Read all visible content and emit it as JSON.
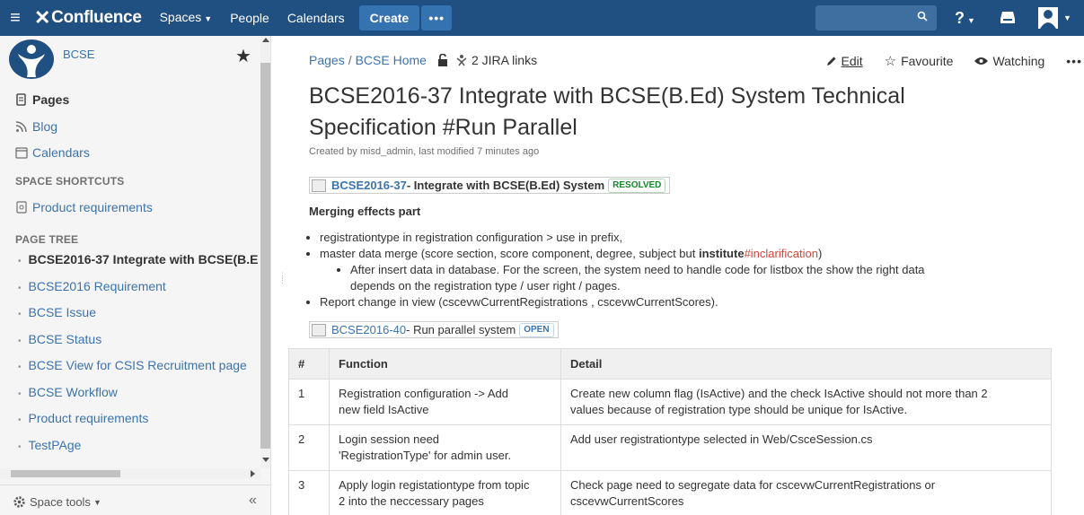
{
  "topbar": {
    "logo": "Confluence",
    "nav": {
      "spaces": "Spaces",
      "people": "People",
      "calendars": "Calendars"
    },
    "create": "Create",
    "more": "•••",
    "colors": {
      "bar": "#205081",
      "button": "#3572b0"
    }
  },
  "sidebar": {
    "space_name": "BCSE",
    "links": {
      "pages": "Pages",
      "blog": "Blog",
      "calendars": "Calendars"
    },
    "shortcuts_heading": "SPACE SHORTCUTS",
    "shortcut": "Product requirements",
    "tree_heading": "PAGE TREE",
    "tree": [
      "BCSE2016-37 Integrate with BCSE(B.E",
      "BCSE2016 Requirement",
      "BCSE Issue",
      "BCSE Status",
      "BCSE View for CSIS Recruitment page",
      "BCSE Workflow",
      "Product requirements",
      "TestPAge"
    ],
    "space_tools": "Space tools",
    "collapse": "«"
  },
  "main": {
    "crumbs": {
      "pages": "Pages",
      "sep": "/",
      "home": "BCSE Home",
      "jira": "2 JIRA links"
    },
    "actions": {
      "edit": "Edit",
      "favourite": "Favourite",
      "watching": "Watching",
      "more": "•••"
    },
    "title": "BCSE2016-37 Integrate with BCSE(B.Ed) System Technical Specification #Run Parallel",
    "byline": "Created by misd_admin, last modified 7 minutes ago",
    "issue1": {
      "key": "BCSE2016-37",
      "summary": " - Integrate with BCSE(B.Ed) System",
      "status": "RESOLVED"
    },
    "merge_heading": "Merging effects part",
    "bullets": {
      "b1": "registrationtype in registration configuration > use in prefix,",
      "b2_pre": "master data merge (score section, score component, degree, subject but ",
      "b2_bold": "institute",
      "b2_red": "#inclarification",
      "b2_post": ")",
      "b2_sub_1": "After insert data in database. For the screen, the system need to handle code for listbox the show the right data",
      "b2_sub_2": "depends on the registration type / user right / pages.",
      "b3": "Report change in view (cscevwCurrentRegistrations , cscevwCurrentScores)."
    },
    "issue2": {
      "key": "BCSE2016-40",
      "summary": " - Run parallel system",
      "status": "OPEN"
    },
    "table": {
      "headers": [
        "#",
        "Function",
        "Detail"
      ],
      "rows": [
        {
          "num": "1",
          "func_1": "Registration configuration -> Add",
          "func_2": "new field IsActive",
          "detail_1": "Create new column flag (IsActive) and the check IsActive should not more than 2",
          "detail_2": "values because of registration type should be unique for IsActive."
        },
        {
          "num": "2",
          "func_1": "Login session need",
          "func_2": "'RegistrationType' for admin user.",
          "detail_1": "Add user registrationtype selected in Web/CsceSession.cs",
          "detail_2": ""
        },
        {
          "num": "3",
          "func_1": "Apply login registationtype from topic",
          "func_2": "2 into the neccessary pages",
          "detail_1": "Check page need to segregate data for cscevwCurrentRegistrations or",
          "detail_2": "cscevwCurrentScores"
        }
      ]
    }
  }
}
